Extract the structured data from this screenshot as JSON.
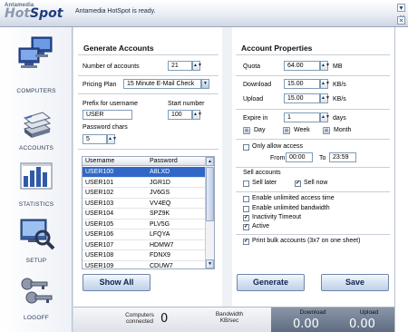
{
  "app": {
    "logo_small": "Antamedia",
    "logo_main_prefix": "Hot",
    "logo_main_suffix": "Spot",
    "status": "Antamedia HotSpot is ready.",
    "window_buttons": [
      "▼",
      "✕"
    ]
  },
  "sidebar": {
    "items": [
      {
        "label": "COMPUTERS",
        "icon": "computers-icon"
      },
      {
        "label": "ACCOUNTS",
        "icon": "accounts-icon"
      },
      {
        "label": "STATISTICS",
        "icon": "statistics-icon"
      },
      {
        "label": "SETUP",
        "icon": "setup-icon"
      },
      {
        "label": "LOGOFF",
        "icon": "logoff-icon"
      }
    ]
  },
  "generate": {
    "title": "Generate Accounts",
    "num_accounts_label": "Number of accounts",
    "num_accounts_value": "21",
    "pricing_plan_label": "Pricing Plan",
    "pricing_plan_value": "15 Minute E-Mail Check",
    "prefix_label": "Prefix for username",
    "prefix_value": "USER",
    "start_number_label": "Start number",
    "start_number_value": "100",
    "password_chars_label": "Password chars",
    "password_chars_value": "5",
    "table": {
      "columns": [
        "Username",
        "Password"
      ],
      "rows": [
        [
          "USER100",
          "A8LXD"
        ],
        [
          "USER101",
          "JGR1D"
        ],
        [
          "USER102",
          "JV6GS"
        ],
        [
          "USER103",
          "VV4EQ"
        ],
        [
          "USER104",
          "SPZ9K"
        ],
        [
          "USER105",
          "PLV5G"
        ],
        [
          "USER106",
          "LFQYA"
        ],
        [
          "USER107",
          "HDMW7"
        ],
        [
          "USER108",
          "FDNX9"
        ],
        [
          "USER109",
          "CDUW7"
        ]
      ],
      "selected_index": 0
    },
    "show_all_label": "Show All",
    "generate_label": "Generate"
  },
  "properties": {
    "title": "Account Properties",
    "quota_label": "Quota",
    "quota_value": "64.00",
    "quota_unit": "MB",
    "download_label": "Download",
    "download_value": "15.00",
    "download_unit": "KB/s",
    "upload_label": "Upload",
    "upload_value": "15.00",
    "upload_unit": "KB/s",
    "expire_label": "Expire in",
    "expire_value": "1",
    "expire_unit": "days",
    "day_label": "Day",
    "week_label": "Week",
    "month_label": "Month",
    "only_allow_label": "Only allow access",
    "only_allow_checked": false,
    "from_label": "From",
    "from_value": "00:00",
    "to_label": "To",
    "to_value": "23:59",
    "sell_accounts_label": "Sell accounts",
    "sell_later_label": "Sell later",
    "sell_later_checked": false,
    "sell_now_label": "Sell now",
    "sell_now_checked": true,
    "options": [
      {
        "label": "Enable unlimited access time",
        "checked": false
      },
      {
        "label": "Enable unlimited bandwidth",
        "checked": false
      },
      {
        "label": "Inactivity Timeout",
        "checked": true
      },
      {
        "label": "Active",
        "checked": true
      }
    ],
    "print_bulk_label": "Print bulk accounts (3x7 on one sheet)",
    "print_bulk_checked": true,
    "save_label": "Save"
  },
  "statusbar": {
    "computers_label": "Computers connected",
    "computers_value": "0",
    "bandwidth_label": "Bandwidth KB/sec",
    "download_label": "Download",
    "download_value": "0.00",
    "upload_label": "Upload",
    "upload_value": "0.00"
  }
}
